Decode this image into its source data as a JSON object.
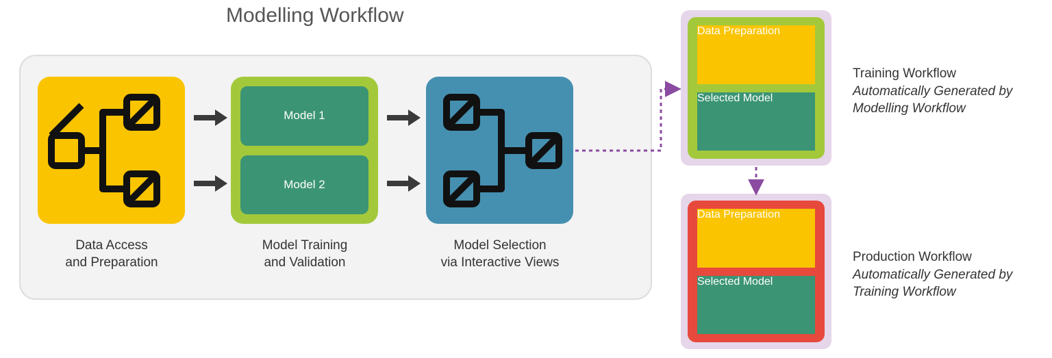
{
  "title": "Modelling Workflow",
  "modelling": {
    "data_caption": "Data Access\nand Preparation",
    "training_caption": "Model Training\nand Validation",
    "selection_caption": "Model Selection\nvia Interactive Views",
    "model1": "Model 1",
    "model2": "Model 2"
  },
  "training_workflow": {
    "title": "Training Workflow",
    "subtitle": "Automatically Generated by Modelling Workflow",
    "box_dp": "Data Preparation",
    "box_sm": "Selected Model"
  },
  "production_workflow": {
    "title": "Production Workflow",
    "subtitle": "Automatically Generated by Training Workflow",
    "box_dp": "Data Preparation",
    "box_sm": "Selected Model"
  },
  "colors": {
    "yellow": "#fac400",
    "olive": "#a3c93b",
    "green": "#3b9474",
    "blue": "#4590b0",
    "red": "#e7493c",
    "lilac": "#e6d6ea",
    "purple_arrow": "#8a4ba0"
  }
}
